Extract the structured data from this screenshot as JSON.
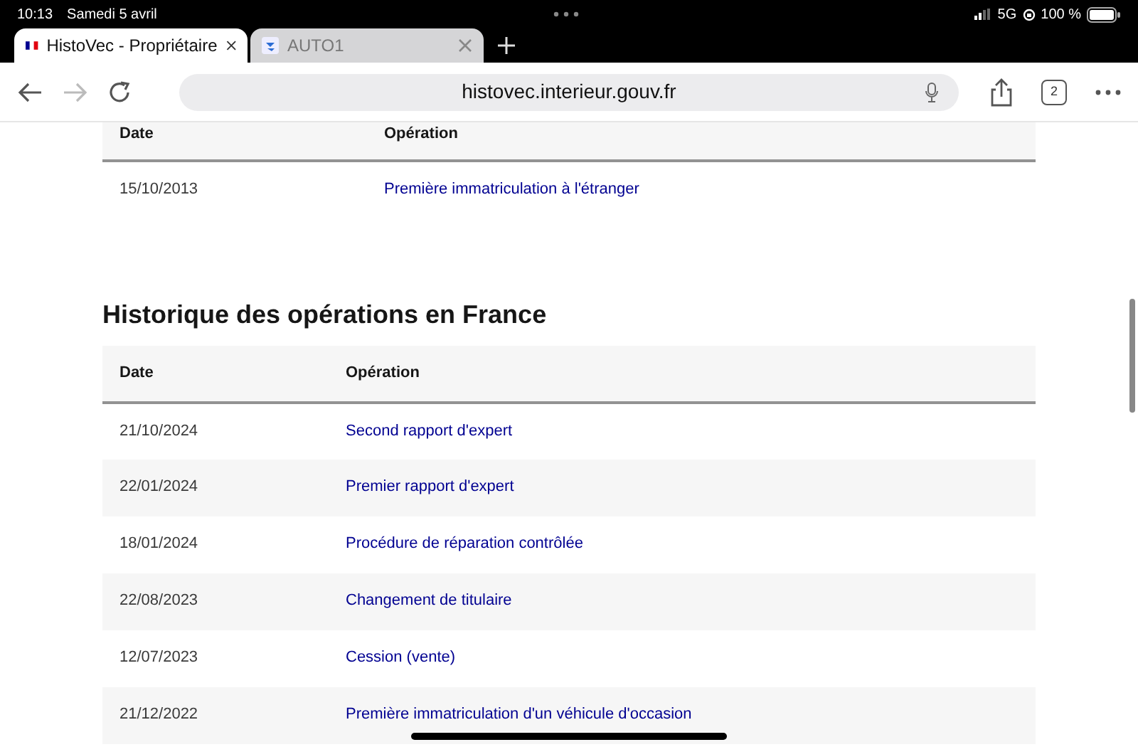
{
  "status_bar": {
    "time": "10:13",
    "date": "Samedi 5 avril",
    "network": "5G",
    "battery": "100 %"
  },
  "tabs": [
    {
      "title": "HistoVec - Propriétaire",
      "selected": true
    },
    {
      "title": "AUTO1",
      "selected": false
    }
  ],
  "address_bar": {
    "url": "histovec.interieur.gouv.fr",
    "tab_count": "2"
  },
  "tables": [
    {
      "columns": [
        "Date",
        "Opération"
      ],
      "rows": [
        {
          "date": "15/10/2013",
          "operation": "Première immatriculation à l'étranger"
        }
      ]
    },
    {
      "title": "Historique des opérations en France",
      "columns": [
        "Date",
        "Opération"
      ],
      "rows": [
        {
          "date": "21/10/2024",
          "operation": "Second rapport d'expert"
        },
        {
          "date": "22/01/2024",
          "operation": "Premier rapport d'expert"
        },
        {
          "date": "18/01/2024",
          "operation": "Procédure de réparation contrôlée"
        },
        {
          "date": "22/08/2023",
          "operation": "Changement de titulaire"
        },
        {
          "date": "12/07/2023",
          "operation": "Cession (vente)"
        },
        {
          "date": "21/12/2022",
          "operation": "Première immatriculation d'un véhicule d'occasion"
        }
      ]
    }
  ]
}
